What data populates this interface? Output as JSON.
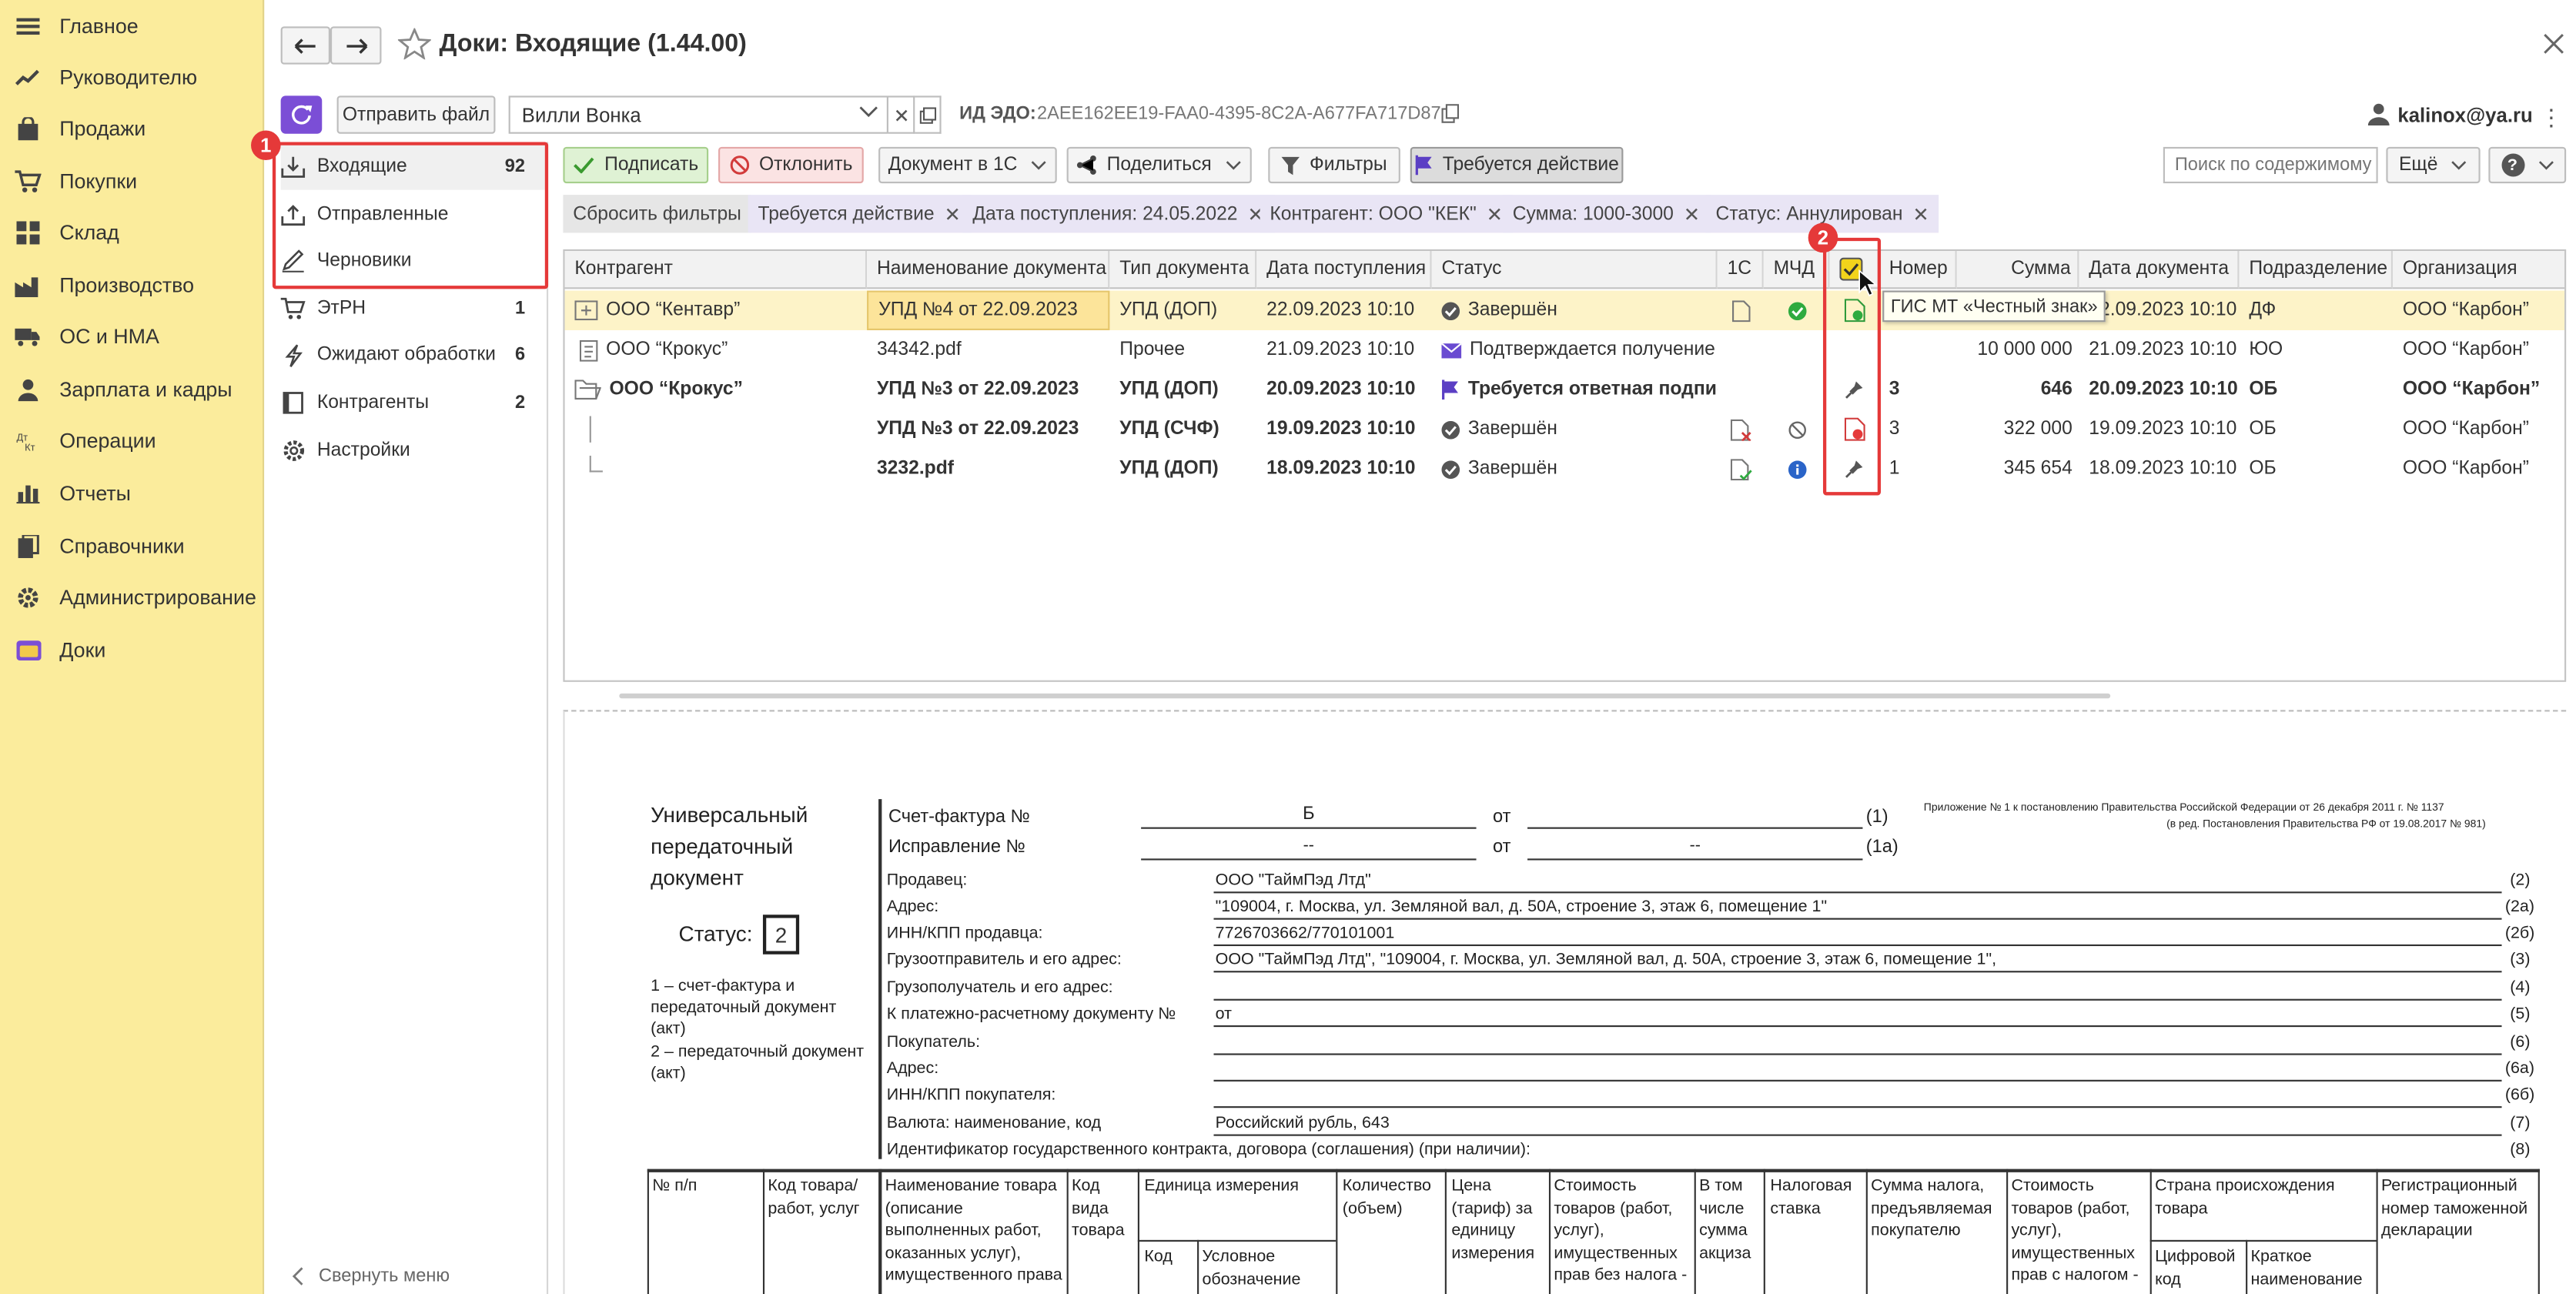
{
  "nav": {
    "items": [
      {
        "label": "Главное",
        "icon": "menu-icon"
      },
      {
        "label": "Руководителю",
        "icon": "trend-icon"
      },
      {
        "label": "Продажи",
        "icon": "bag-icon"
      },
      {
        "label": "Покупки",
        "icon": "cart-icon"
      },
      {
        "label": "Склад",
        "icon": "grid-icon"
      },
      {
        "label": "Производство",
        "icon": "factory-icon"
      },
      {
        "label": "ОС и НМА",
        "icon": "truck-icon"
      },
      {
        "label": "Зарплата и кадры",
        "icon": "person-icon"
      },
      {
        "label": "Операции",
        "icon": "dtkt-icon"
      },
      {
        "label": "Отчеты",
        "icon": "bars-icon"
      },
      {
        "label": "Справочники",
        "icon": "books-icon"
      },
      {
        "label": "Администрирование",
        "icon": "gear-icon"
      },
      {
        "label": "Доки",
        "icon": "doki-icon"
      }
    ]
  },
  "header": {
    "title": "Доки: Входящие (1.44.00)",
    "send_file": "Отправить файл",
    "counterparty_value": "Вилли Вонка",
    "edo_label": "ИД ЭДО:",
    "edo_value": "2AEE162EE19-FAA0-4395-8C2A-A677FA717D87",
    "user": "kalinox@ya.ru"
  },
  "sidebar": {
    "items": [
      {
        "label": "Входящие",
        "count": "92"
      },
      {
        "label": "Отправленные",
        "count": ""
      },
      {
        "label": "Черновики",
        "count": ""
      },
      {
        "label": "ЭтРН",
        "count": "1"
      },
      {
        "label": "Ожидают обработки",
        "count": "6"
      },
      {
        "label": "Контрагенты",
        "count": "2"
      },
      {
        "label": "Настройки",
        "count": ""
      }
    ],
    "collapse": "Свернуть меню"
  },
  "toolbar": {
    "sign": "Подписать",
    "reject": "Отклонить",
    "doc_1c": "Документ в 1С",
    "share": "Поделиться",
    "filters": "Фильтры",
    "action_required": "Требуется действие",
    "search_placeholder": "Поиск по содержимому",
    "more": "Ещё",
    "help": "?"
  },
  "chips": {
    "reset": "Сбросить фильтры",
    "items": [
      "Требуется действие",
      "Дата поступления: 24.05.2022",
      "Контрагент: ООО \"КЕК\"",
      "Сумма: 1000-3000",
      "Статус: Аннулирован"
    ]
  },
  "table": {
    "columns": [
      "Контрагент",
      "Наименование документа",
      "Тип документа",
      "Дата поступления",
      "Статус",
      "1С",
      "МЧД",
      "",
      "Номер",
      "Сумма",
      "Дата документа",
      "Подразделение",
      "Организация"
    ],
    "rows": [
      {
        "kontragent": "ООО “Кентавр”",
        "name": "УПД №4 от 22.09.2023",
        "type": "УПД (ДОП)",
        "date_in": "22.09.2023 10:10",
        "status": "Завершён",
        "number": "",
        "sum": "",
        "date_doc": "22.09.2023 10:10",
        "dept": "ДФ",
        "org": "ООО “Карбон”"
      },
      {
        "kontragent": "ООО “Крокус”",
        "name": "34342.pdf",
        "type": "Прочее",
        "date_in": "21.09.2023 10:10",
        "status": "Подтверждается получение",
        "number": "",
        "sum": "10 000 000",
        "date_doc": "21.09.2023 10:10",
        "dept": "ЮО",
        "org": "ООО “Карбон”"
      },
      {
        "kontragent": "ООО “Крокус”",
        "name": "УПД №3 от 22.09.2023",
        "type": "УПД (ДОП)",
        "date_in": "20.09.2023 10:10",
        "status": "Требуется ответная подпись",
        "number": "3",
        "sum": "646",
        "date_doc": "20.09.2023 10:10",
        "dept": "ОБ",
        "org": "ООО “Карбон”"
      },
      {
        "kontragent": "",
        "name": "УПД №3 от 22.09.2023",
        "type": "УПД (СЧФ)",
        "date_in": "19.09.2023 10:10",
        "status": "Завершён",
        "number": "3",
        "sum": "322 000",
        "date_doc": "19.09.2023 10:10",
        "dept": "ОБ",
        "org": "ООО “Карбон”"
      },
      {
        "kontragent": "",
        "name": "3232.pdf",
        "type": "УПД (ДОП)",
        "date_in": "18.09.2023 10:10",
        "status": "Завершён",
        "number": "1",
        "sum": "345 654",
        "date_doc": "18.09.2023 10:10",
        "dept": "ОБ",
        "org": "ООО “Карбон”"
      }
    ],
    "tooltip": "ГИС МТ «Честный знак»"
  },
  "markers": {
    "one": "1",
    "two": "2"
  },
  "doc": {
    "title_l1": "Универсальный",
    "title_l2": "передаточный",
    "title_l3": "документ",
    "status_label": "Статус:",
    "status_value": "2",
    "legend1_l1": "1 – счет-фактура и",
    "legend1_l2": "передаточный документ",
    "legend1_l3": "(акт)",
    "legend2_l1": "2 – передаточный документ",
    "legend2_l2": "(акт)",
    "invoice_label": "Счет-фактура №",
    "invoice_no": "Б",
    "from1": "от",
    "code1": "(1)",
    "correction_label": "Исправление №",
    "correction_no": "--",
    "from2": "от",
    "correction_date": "--",
    "code1a": "(1а)",
    "annex_l1": "Приложение № 1 к постановлению Правительства Российской Федерации от 26 декабря 2011 г. № 1137",
    "annex_l2": "(в ред. Постановления Правительства РФ от 19.08.2017 № 981)",
    "lines": [
      {
        "label": "Продавец:",
        "value": "ООО \"ТаймПэд Лтд\"",
        "code": "(2)"
      },
      {
        "label": "Адрес:",
        "value": "\"109004, г. Москва, ул. Земляной вал, д. 50А, строение 3, этаж 6, помещение 1\"",
        "code": "(2а)"
      },
      {
        "label": "ИНН/КПП продавца:",
        "value": "7726703662/770101001",
        "code": "(2б)"
      },
      {
        "label": "Грузоотправитель и его адрес:",
        "value": "ООО \"ТаймПэд Лтд\", \"109004, г. Москва, ул. Земляной вал, д. 50А, строение 3, этаж 6, помещение 1\",",
        "code": "(3)"
      },
      {
        "label": "Грузополучатель и его адрес:",
        "value": "",
        "code": "(4)"
      },
      {
        "label": "К платежно-расчетному документу №",
        "value": "от",
        "code": "(5)"
      },
      {
        "label": "Покупатель:",
        "value": "",
        "code": "(6)"
      },
      {
        "label": "Адрес:",
        "value": "",
        "code": "(6а)"
      },
      {
        "label": "ИНН/КПП покупателя:",
        "value": "",
        "code": "(6б)"
      },
      {
        "label": "Валюта: наименование, код",
        "value": "Российский рубль, 643",
        "code": "(7)"
      },
      {
        "label": "Идентификатор государственного контракта, договора (соглашения) (при наличии):",
        "value": "",
        "code": "(8)"
      }
    ],
    "tcols": [
      "№ п/п",
      "Код товара/ работ, услуг",
      "Наименование товара (описание выполненных работ, оказанных услуг), имущественного права",
      "Код вида товара",
      "Единица измерения",
      "Количество (объем)",
      "Цена (тариф) за единицу измерения",
      "Стоимость товаров (работ, услуг), имущественных прав без налога - всего",
      "В том числе сумма акциза",
      "Налоговая ставка",
      "Сумма налога, предъявляемая покупателю",
      "Стоимость товаров (работ, услуг), имущественных прав с налогом - всего",
      "Страна происхождения товара",
      "Регистрационный номер таможенной декларации"
    ],
    "sub_code": "Код",
    "sub_cond": "Условное обозначение (национальное)",
    "sub_digital": "Цифровой код",
    "sub_short": "Краткое наименование"
  },
  "colors": {
    "nav_bg": "#fbec9c",
    "accent": "#7b4ed6",
    "highlight": "#e53939",
    "selected_row": "#fdf3c8"
  }
}
